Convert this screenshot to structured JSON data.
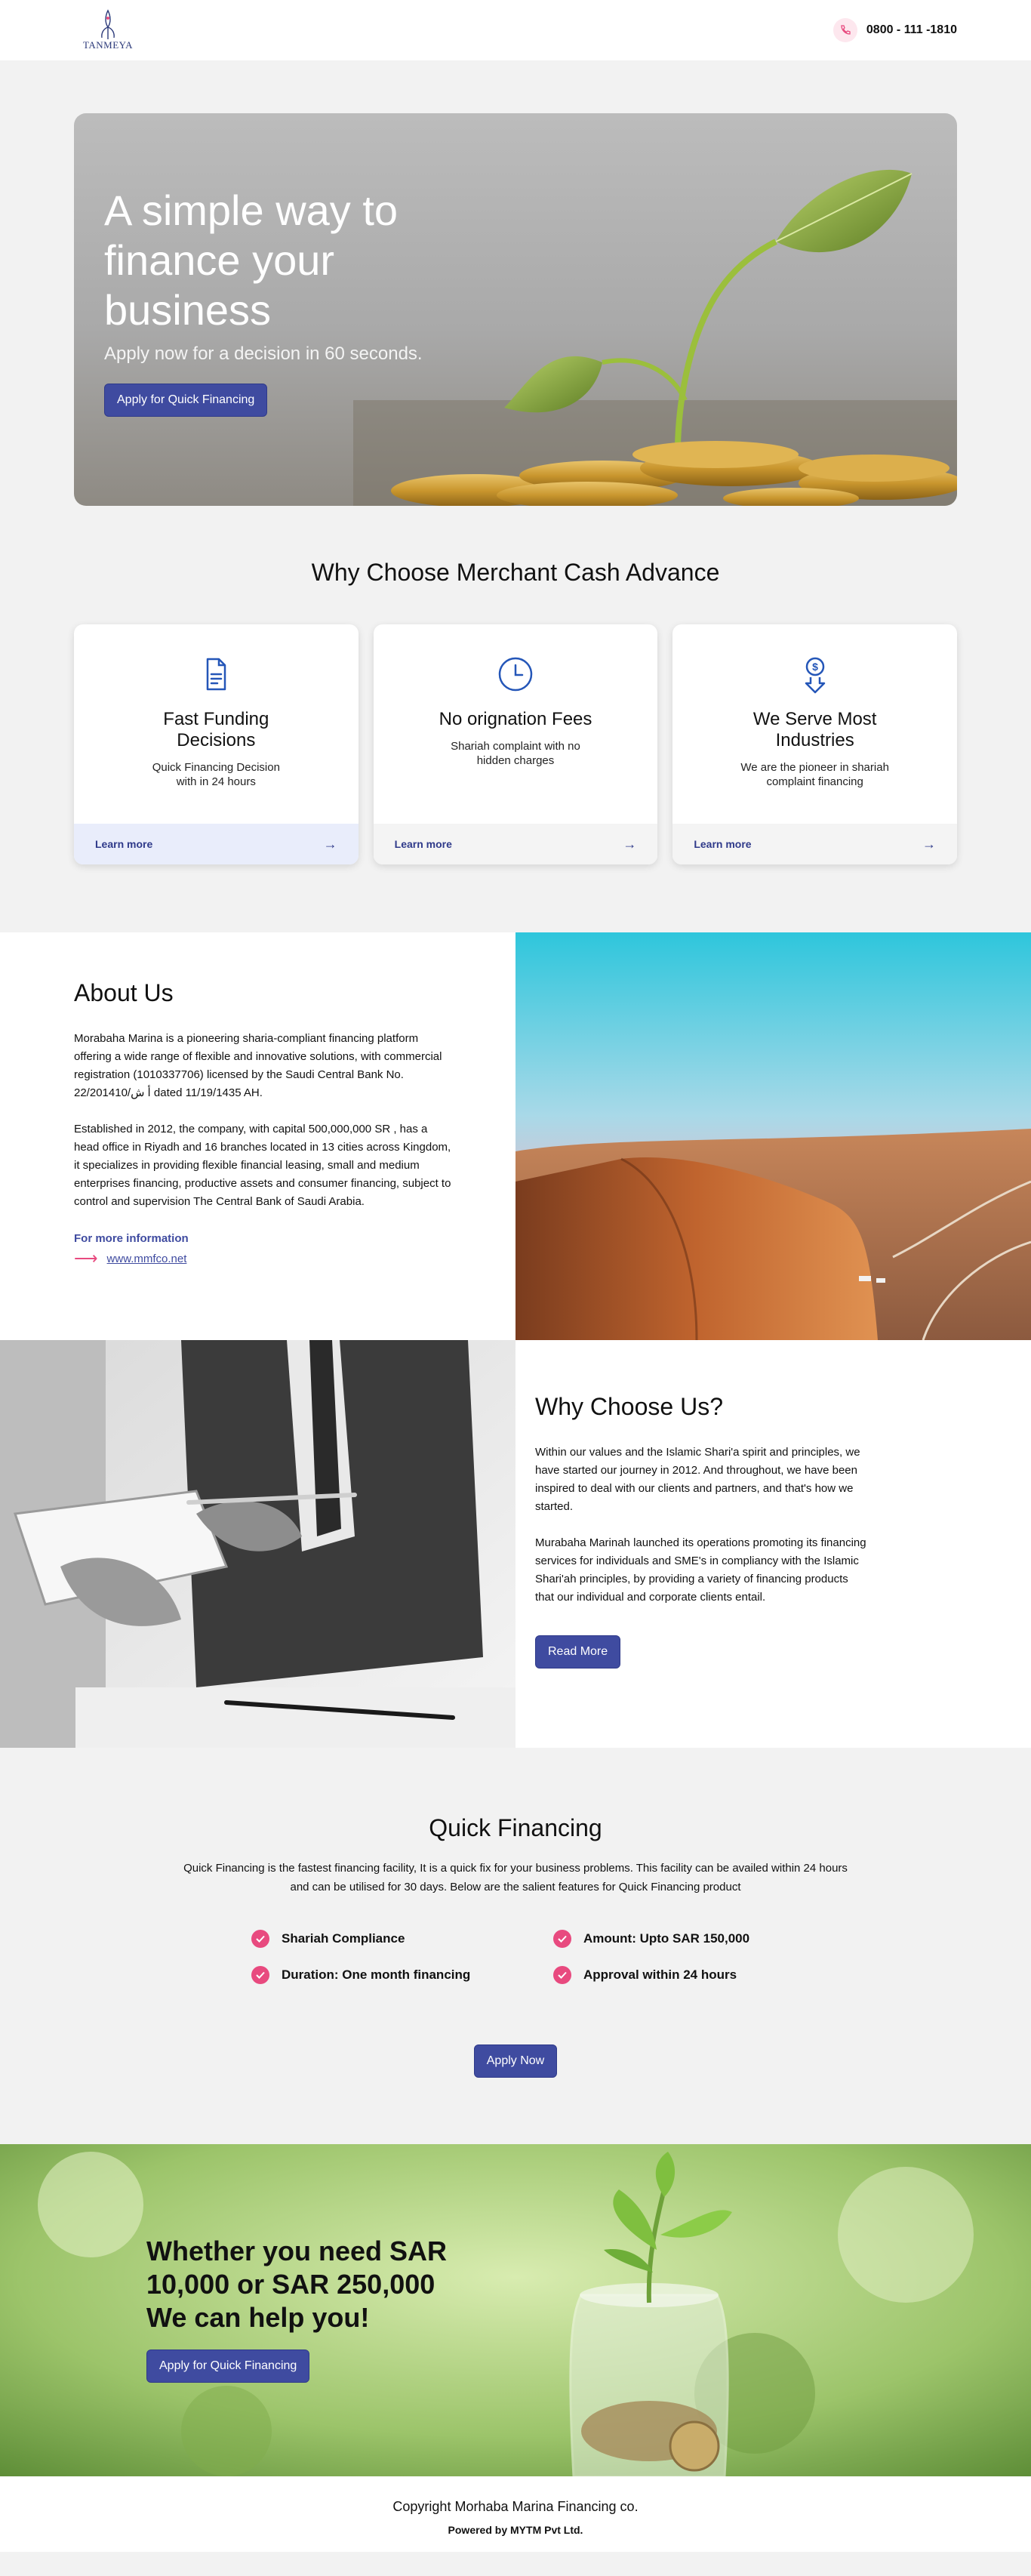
{
  "header": {
    "logo_text": "TANMEYA",
    "phone": "0800 - 111 -1810"
  },
  "hero": {
    "title": "A simple way to finance your business",
    "subtitle": "Apply now for a decision in 60 seconds.",
    "button": "Apply for Quick Financing"
  },
  "why": {
    "title": "Why Choose Merchant Cash Advance",
    "cards": [
      {
        "icon": "document-icon",
        "title": "Fast Funding Decisions",
        "desc": "Quick Financing Decision with in 24 hours",
        "link": "Learn more"
      },
      {
        "icon": "clock-icon",
        "title": "No orignation Fees",
        "desc": "Shariah complaint with no hidden charges",
        "link": "Learn more"
      },
      {
        "icon": "dollar-down-icon",
        "title": "We Serve Most Industries",
        "desc": "We are the pioneer in shariah complaint financing",
        "link": "Learn more"
      }
    ]
  },
  "about": {
    "title": "About Us",
    "para1": "Morabaha Marina is a pioneering sharia-compliant financing platform offering a wide range of flexible and innovative solutions, with commercial registration (1010337706) licensed by the Saudi Central Bank No. 22/201410/أ ش dated 11/19/1435 AH.",
    "para2": "Established in 2012, the company, with capital 500,000,000 SR , has a head office in Riyadh and 16 branches located in 13 cities across Kingdom, it specializes in providing flexible financial leasing, small and medium enterprises financing, productive assets and consumer financing, subject to control and supervision The Central Bank of Saudi Arabia.",
    "more_label": "For more information",
    "url": "www.mmfco.net"
  },
  "choose": {
    "title": "Why Choose Us?",
    "para1": "Within our values and the Islamic Shari'a spirit and principles, we have started our journey in 2012. And throughout, we have been inspired to deal with our clients and partners, and that's how we started.",
    "para2": "Murabaha Marinah launched its operations promoting its financing services for individuals and SME's in compliancy with the Islamic Shari'ah principles, by providing a variety of financing products that our individual and corporate clients entail.",
    "button": "Read More"
  },
  "quick": {
    "title": "Quick Financing",
    "desc": "Quick Financing is the fastest financing facility, It is a quick fix for your business problems. This facility can be availed within 24 hours and can be utilised for 30 days. Below are the salient features for Quick Financing product",
    "features": [
      "Shariah Compliance",
      "Amount: Upto SAR 150,000",
      "Duration: One month financing",
      "Approval within 24 hours"
    ],
    "button": "Apply Now"
  },
  "banner": {
    "title": "Whether you need SAR 10,000 or SAR 250,000 We can help you!",
    "button": "Apply for Quick Financing"
  },
  "footer": {
    "copyright": "Copyright Morhaba Marina Financing co.",
    "powered": "Powered by MYTM Pvt Ltd."
  },
  "colors": {
    "primary": "#3f4ba0",
    "accent": "#e84a7f",
    "background": "#f2f2f2"
  }
}
